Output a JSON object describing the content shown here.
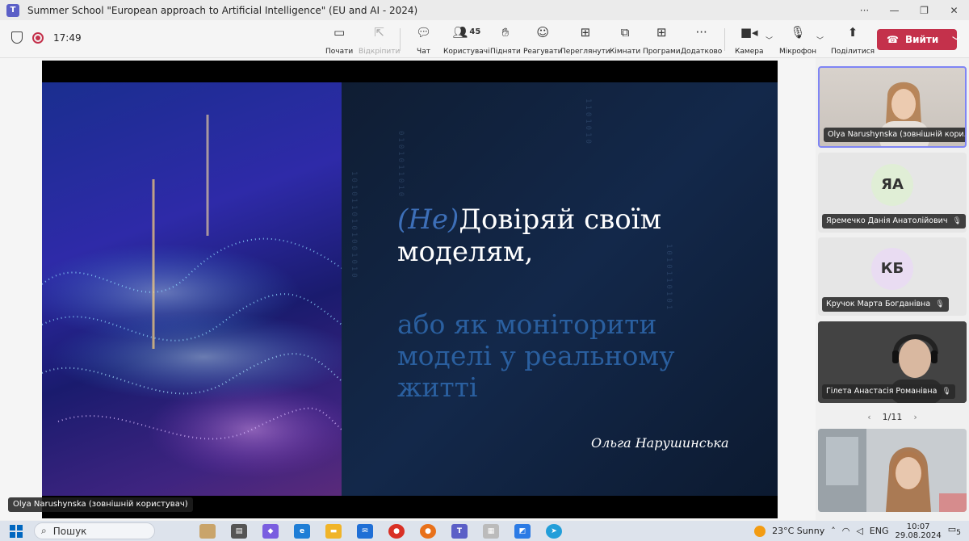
{
  "window": {
    "title": "Summer School \"European approach to Artificial Intelligence\" (EU and AI - 2024)",
    "app_icon": "teams-icon"
  },
  "toolbar": {
    "timer": "17:49",
    "participants_count": "45",
    "buttons": {
      "share": "Почати",
      "pin": "Відкріпити",
      "chat": "Чат",
      "people": "Користувачі",
      "raise": "Підняти",
      "react": "Реагувати",
      "view": "Переглянути",
      "rooms": "Кімнати",
      "apps": "Програми",
      "more": "Додатково",
      "camera": "Камера",
      "mic": "Мікрофон",
      "share_screen": "Поділитися",
      "leave": "Вийти"
    }
  },
  "slide": {
    "title_prefix": "(Не)",
    "title_line1": "Довіряй своїм",
    "title_line2": "моделям,",
    "subtitle_line1": "або як моніторити",
    "subtitle_line2": "моделі у реальному",
    "subtitle_line3": "житті",
    "author": "Ольга Нарушинська"
  },
  "presenter_label": "Olya Narushynska (зовнішній користувач)",
  "participants": [
    {
      "name": "Olya Narushynska (зовнішній кори...",
      "type": "video"
    },
    {
      "name": "Яремечко Данія Анатолійович",
      "initials": "ЯА",
      "type": "avatar",
      "avatar_color": "#e0eed6"
    },
    {
      "name": "Кручок Марта Богданівна",
      "initials": "КБ",
      "type": "avatar",
      "avatar_color": "#e9dcf2"
    },
    {
      "name": "Гілета Анастасія Романівна",
      "type": "video"
    }
  ],
  "pager": "1/11",
  "taskbar": {
    "search_placeholder": "Пошук",
    "weather": "23°C  Sunny",
    "lang": "ENG",
    "time": "10:07",
    "date": "29.08.2024",
    "notification_count": "5"
  }
}
